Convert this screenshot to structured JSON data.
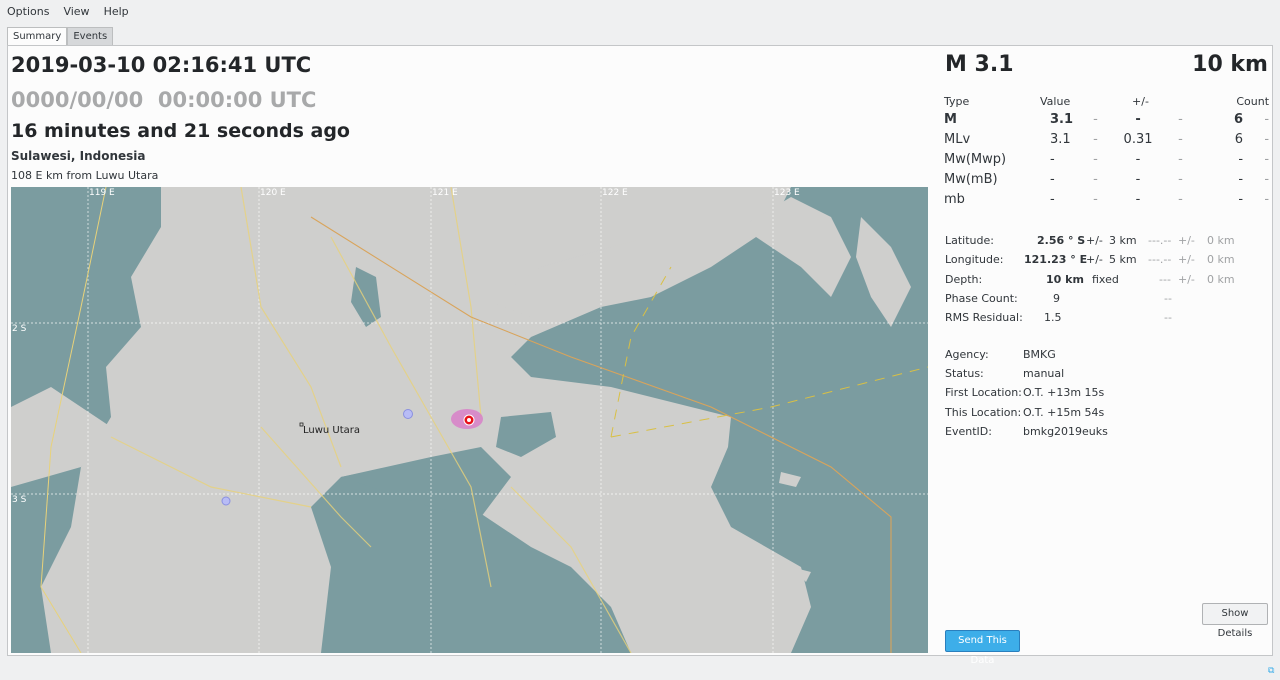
{
  "menu": {
    "options": "Options",
    "view": "View",
    "help": "Help"
  },
  "tabs": {
    "summary": "Summary",
    "events": "Events"
  },
  "event": {
    "origin_time": "2019-03-10 02:16:41 UTC",
    "placeholder_time": "0000/00/00  00:00:00 UTC",
    "elapsed": "16 minutes and 21 seconds ago",
    "region": "Sulawesi, Indonesia",
    "distance": "108 E km from Luwu Utara"
  },
  "summary": {
    "magnitude": "M 3.1",
    "depth": "10 km"
  },
  "mag_table": {
    "headers": {
      "type": "Type",
      "value": "Value",
      "pm": "+/-",
      "count": "Count"
    },
    "rows": [
      {
        "type": "M",
        "value": "3.1",
        "d1": "-",
        "unc": "-",
        "d2": "-",
        "count": "6",
        "d3": "-"
      },
      {
        "type": "MLv",
        "value": "3.1",
        "d1": "-",
        "unc": "0.31",
        "d2": "-",
        "count": "6",
        "d3": "-"
      },
      {
        "type": "Mw(Mwp)",
        "value": "-",
        "d1": "-",
        "unc": "-",
        "d2": "-",
        "count": "-",
        "d3": "-"
      },
      {
        "type": "Mw(mB)",
        "value": "-",
        "d1": "-",
        "unc": "-",
        "d2": "-",
        "count": "-",
        "d3": "-"
      },
      {
        "type": "mb",
        "value": "-",
        "d1": "-",
        "unc": "-",
        "d2": "-",
        "count": "-",
        "d3": "-"
      }
    ]
  },
  "location": {
    "lat_label": "Latitude:",
    "lat_value": "2.56 ° S",
    "lat_pm": "+/-",
    "lat_unc": "3 km",
    "lat_alt": "---.--",
    "lat_pm2": "+/-",
    "lat_alt_unc": "0 km",
    "lon_label": "Longitude:",
    "lon_value": "121.23 ° E",
    "lon_pm": "+/-",
    "lon_unc": "5 km",
    "lon_alt": "---.--",
    "lon_pm2": "+/-",
    "lon_alt_unc": "0 km",
    "depth_label": "Depth:",
    "depth_value": "10 km",
    "depth_fixed": "fixed",
    "depth_alt": "---",
    "depth_pm2": "+/-",
    "depth_alt_unc": "0 km",
    "phase_label": "Phase Count:",
    "phase_value": "9",
    "phase_alt": "--",
    "rms_label": "RMS Residual:",
    "rms_value": "1.5",
    "rms_alt": "--"
  },
  "meta": {
    "agency_label": "Agency:",
    "agency": "BMKG",
    "status_label": "Status:",
    "status": "manual",
    "first_label": "First Location:",
    "first": "O.T. +13m 15s",
    "this_label": "This Location:",
    "this": "O.T. +15m 54s",
    "eventid_label": "EventID:",
    "eventid": "bmkg2019euks"
  },
  "map": {
    "lon_labels": [
      "119 E",
      "120 E",
      "121 E",
      "122 E",
      "123 E"
    ],
    "lat_labels": [
      "2 S",
      "3 S"
    ],
    "city": "Luwu Utara"
  },
  "buttons": {
    "details": "Show Details",
    "send": "Send This Data"
  },
  "colors": {
    "accent": "#3daee9",
    "land": "#cfcfcd",
    "water": "#7b9ca0",
    "epicenter": "#e8101a"
  }
}
